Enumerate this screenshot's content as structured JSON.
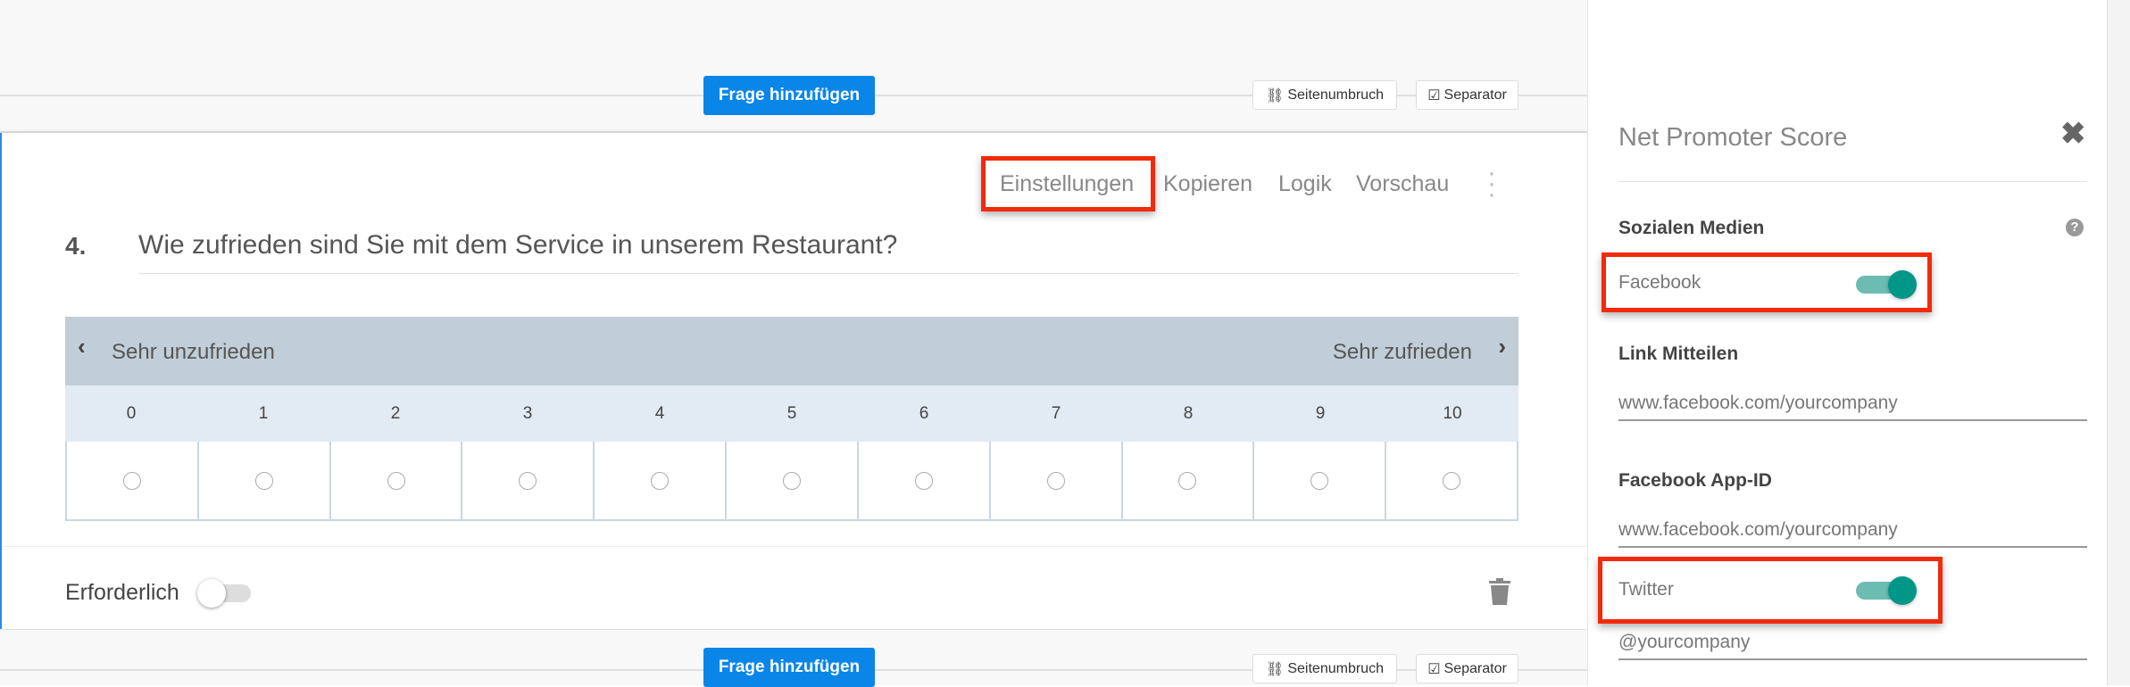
{
  "builder": {
    "add_question_label": "Frage hinzufügen",
    "page_break_label": "Seitenumbruch",
    "separator_label": "Separator"
  },
  "question": {
    "toolbar": {
      "settings": "Einstellungen",
      "copy": "Kopieren",
      "logic": "Logik",
      "preview": "Vorschau"
    },
    "number": "4.",
    "text": "Wie zufrieden sind Sie mit dem Service in unserem Restaurant?",
    "scale": {
      "left_label": "Sehr unzufrieden",
      "right_label": "Sehr zufrieden",
      "values": [
        "0",
        "1",
        "2",
        "3",
        "4",
        "5",
        "6",
        "7",
        "8",
        "9",
        "10"
      ]
    },
    "required_label": "Erforderlich",
    "required": false
  },
  "panel": {
    "title": "Net Promoter Score",
    "social_media_label": "Sozialen Medien",
    "facebook_label": "Facebook",
    "facebook_enabled": true,
    "share_link_label": "Link Mitteilen",
    "share_link_value": "www.facebook.com/yourcompany",
    "app_id_label": "Facebook App-ID",
    "app_id_value": "www.facebook.com/yourcompany",
    "twitter_label": "Twitter",
    "twitter_enabled": true,
    "twitter_value": "@yourcompany"
  },
  "colors": {
    "accent": "#0a86e8",
    "highlight": "#f22a0c",
    "toggle": "#009688"
  }
}
